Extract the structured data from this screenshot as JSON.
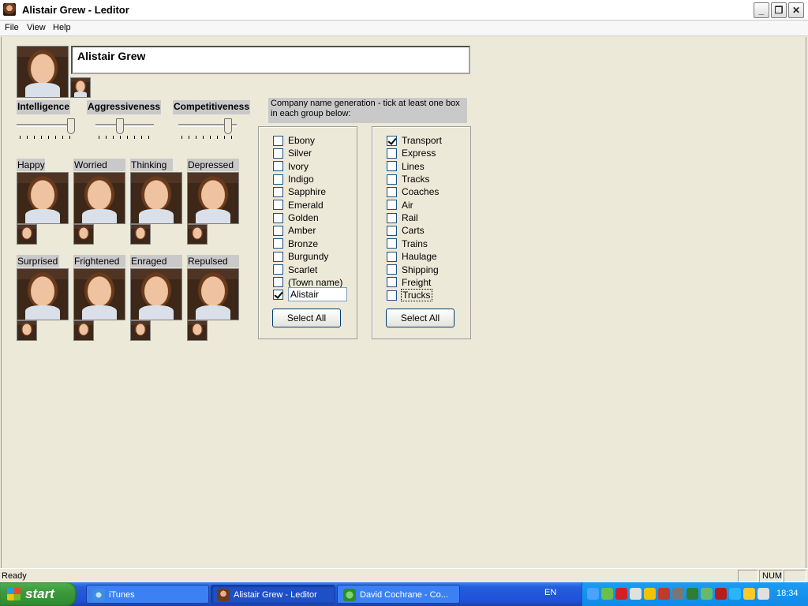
{
  "window": {
    "title": "Alistair Grew - Leditor"
  },
  "menu": [
    "File",
    "View",
    "Help"
  ],
  "character": {
    "name": "Alistair Grew"
  },
  "sliders": [
    {
      "label": "Intelligence",
      "value": 1.0
    },
    {
      "label": "Aggressiveness",
      "value": 0.4
    },
    {
      "label": "Competitiveness",
      "value": 0.9
    }
  ],
  "emotions": [
    "Happy",
    "Worried",
    "Thinking",
    "Depressed",
    "Surprised",
    "Frightened",
    "Enraged",
    "Repulsed"
  ],
  "company": {
    "label": "Company name generation - tick at least one box in each group below:",
    "group1": {
      "items": [
        {
          "label": "Ebony",
          "checked": false
        },
        {
          "label": "Silver",
          "checked": false
        },
        {
          "label": "Ivory",
          "checked": false
        },
        {
          "label": "Indigo",
          "checked": false
        },
        {
          "label": "Sapphire",
          "checked": false
        },
        {
          "label": "Emerald",
          "checked": false
        },
        {
          "label": "Golden",
          "checked": false
        },
        {
          "label": "Amber",
          "checked": false
        },
        {
          "label": "Bronze",
          "checked": false
        },
        {
          "label": "Burgundy",
          "checked": false
        },
        {
          "label": "Scarlet",
          "checked": false
        },
        {
          "label": "(Town name)",
          "checked": false
        }
      ],
      "custom": {
        "value": "Alistair",
        "checked": true
      },
      "select_all": "Select All"
    },
    "group2": {
      "items": [
        {
          "label": "Transport",
          "checked": true
        },
        {
          "label": "Express",
          "checked": false
        },
        {
          "label": "Lines",
          "checked": false
        },
        {
          "label": "Tracks",
          "checked": false
        },
        {
          "label": "Coaches",
          "checked": false
        },
        {
          "label": "Air",
          "checked": false
        },
        {
          "label": "Rail",
          "checked": false
        },
        {
          "label": "Carts",
          "checked": false
        },
        {
          "label": "Trains",
          "checked": false
        },
        {
          "label": "Haulage",
          "checked": false
        },
        {
          "label": "Shipping",
          "checked": false
        },
        {
          "label": "Freight",
          "checked": false
        },
        {
          "label": "Trucks",
          "checked": false
        }
      ],
      "select_all": "Select All"
    }
  },
  "statusbar": {
    "text": "Ready",
    "num": "NUM"
  },
  "taskbar": {
    "start": "start",
    "buttons": [
      "iTunes",
      "Alistair Grew - Leditor",
      "David Cochrane - Co..."
    ],
    "lang": "EN",
    "clock": "18:34"
  },
  "colors": {
    "taskbar": "#245edb",
    "start": "#3c9a3c",
    "tray": "#0f8ae8",
    "checkmark": "#21a121"
  }
}
